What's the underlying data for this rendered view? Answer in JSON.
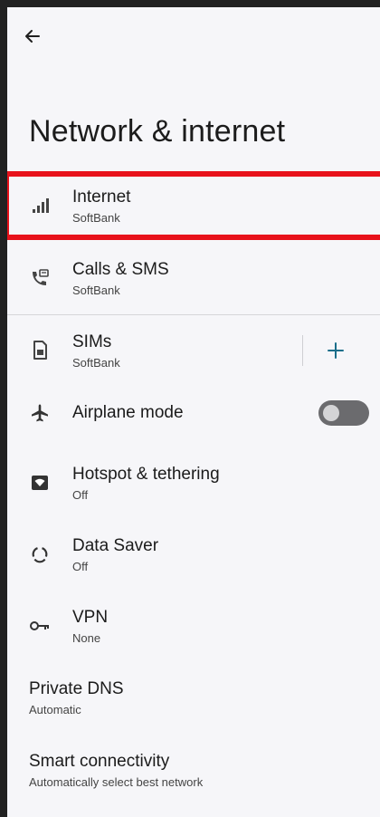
{
  "header": {
    "title": "Network & internet"
  },
  "items": [
    {
      "label": "Internet",
      "sub": "SoftBank"
    },
    {
      "label": "Calls & SMS",
      "sub": "SoftBank"
    },
    {
      "label": "SIMs",
      "sub": "SoftBank"
    },
    {
      "label": "Airplane mode",
      "toggle_on": false
    },
    {
      "label": "Hotspot & tethering",
      "sub": "Off"
    },
    {
      "label": "Data Saver",
      "sub": "Off"
    },
    {
      "label": "VPN",
      "sub": "None"
    },
    {
      "label": "Private DNS",
      "sub": "Automatic"
    },
    {
      "label": "Smart connectivity",
      "sub": "Automatically select best network"
    }
  ],
  "colors": {
    "highlight": "#e8121b",
    "accent": "#1a6e8a",
    "toggle_off": "#6b6b6e"
  },
  "icons": [
    "back-arrow-icon",
    "signal-icon",
    "calls-sms-icon",
    "sim-card-icon",
    "add-icon",
    "airplane-icon",
    "hotspot-icon",
    "data-saver-icon",
    "vpn-key-icon"
  ]
}
